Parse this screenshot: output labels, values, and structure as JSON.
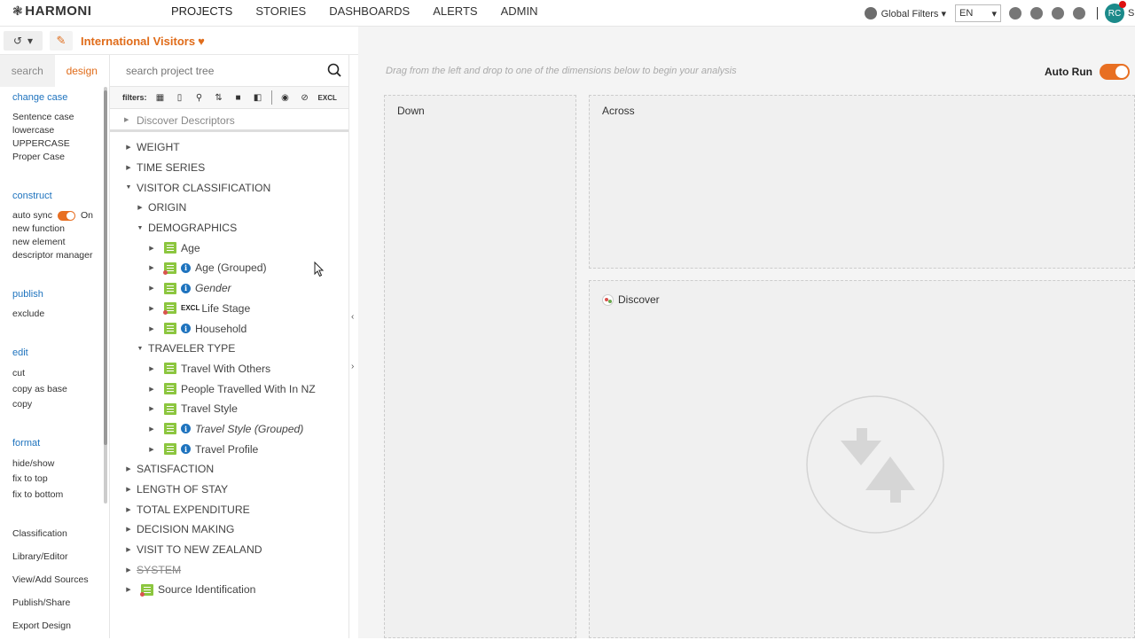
{
  "brand": {
    "name": "HARMONI"
  },
  "nav": [
    "PROJECTS",
    "STORIES",
    "DASHBOARDS",
    "ALERTS",
    "ADMIN"
  ],
  "header_right": {
    "global_filters": "Global Filters",
    "language": "EN",
    "avatar_initials": "RC",
    "user_initial": "S"
  },
  "project": {
    "title": "International Visitors"
  },
  "tool_tabs": {
    "search": "search",
    "design": "design"
  },
  "tools": {
    "change_case": {
      "head": "change case",
      "items": [
        "Sentence case",
        "lowercase",
        "UPPERCASE",
        "Proper Case"
      ]
    },
    "construct": {
      "head": "construct",
      "auto_sync_label": "auto sync",
      "auto_sync_state": "On",
      "items": [
        "new function",
        "new element",
        "descriptor manager"
      ]
    },
    "publish": {
      "head": "publish",
      "items": [
        "exclude"
      ]
    },
    "edit": {
      "head": "edit",
      "items": [
        "cut",
        "copy as base",
        "copy"
      ]
    },
    "format": {
      "head": "format",
      "items": [
        "hide/show",
        "fix to top",
        "fix to bottom"
      ]
    },
    "undo": {
      "head": "undo"
    }
  },
  "tool_footer": [
    "Classification",
    "Library/Editor",
    "View/Add Sources",
    "Publish/Share",
    "Export Design"
  ],
  "tree_search": {
    "placeholder": "search project tree"
  },
  "filters": {
    "label": "filters:",
    "excl": "EXCL"
  },
  "discover_descriptors": "Discover Descriptors",
  "tree": [
    {
      "label": "WEIGHT",
      "level": 0,
      "caret": "right",
      "icon": "none"
    },
    {
      "label": "TIME SERIES",
      "level": 0,
      "caret": "right",
      "icon": "none"
    },
    {
      "label": "VISITOR CLASSIFICATION",
      "level": 0,
      "caret": "down",
      "icon": "none"
    },
    {
      "label": "ORIGIN",
      "level": 1,
      "caret": "right",
      "icon": "none"
    },
    {
      "label": "DEMOGRAPHICS",
      "level": 1,
      "caret": "down",
      "icon": "none"
    },
    {
      "label": "Age",
      "level": 2,
      "caret": "right",
      "icon": "field"
    },
    {
      "label": "Age (Grouped)",
      "level": 2,
      "caret": "right",
      "icon": "field-flag-info"
    },
    {
      "label": "Gender",
      "level": 2,
      "caret": "right",
      "icon": "field-info",
      "italic": true
    },
    {
      "label": "Life Stage",
      "level": 2,
      "caret": "right",
      "icon": "field-flag-excl"
    },
    {
      "label": "Household",
      "level": 2,
      "caret": "right",
      "icon": "field-info"
    },
    {
      "label": "TRAVELER TYPE",
      "level": 1,
      "caret": "down",
      "icon": "none"
    },
    {
      "label": "Travel With Others",
      "level": 2,
      "caret": "right",
      "icon": "field"
    },
    {
      "label": "People Travelled With In NZ",
      "level": 2,
      "caret": "right",
      "icon": "field"
    },
    {
      "label": "Travel Style",
      "level": 2,
      "caret": "right",
      "icon": "field"
    },
    {
      "label": "Travel Style (Grouped)",
      "level": 2,
      "caret": "right",
      "icon": "field-info",
      "italic": true
    },
    {
      "label": "Travel Profile",
      "level": 2,
      "caret": "right",
      "icon": "field-info"
    },
    {
      "label": "SATISFACTION",
      "level": 0,
      "caret": "right",
      "icon": "none"
    },
    {
      "label": "LENGTH OF STAY",
      "level": 0,
      "caret": "right",
      "icon": "none"
    },
    {
      "label": "TOTAL EXPENDITURE",
      "level": 0,
      "caret": "right",
      "icon": "none"
    },
    {
      "label": "DECISION MAKING",
      "level": 0,
      "caret": "right",
      "icon": "none"
    },
    {
      "label": "VISIT TO NEW ZEALAND",
      "level": 0,
      "caret": "right",
      "icon": "none"
    },
    {
      "label": "SYSTEM",
      "level": 0,
      "caret": "right",
      "icon": "none",
      "strike": true
    },
    {
      "label": "Source Identification",
      "level": 0,
      "caret": "right",
      "icon": "field-flag"
    }
  ],
  "main": {
    "hint": "Drag from the left and drop to one of the dimensions below to begin your analysis",
    "auto_run": "Auto Run",
    "zone_down": "Down",
    "zone_across": "Across",
    "zone_discover": "Discover"
  },
  "colors": {
    "accent": "#e86f22",
    "link": "#1e73be",
    "field_icon": "#8cc63f",
    "avatar": "#1b8a8a"
  }
}
